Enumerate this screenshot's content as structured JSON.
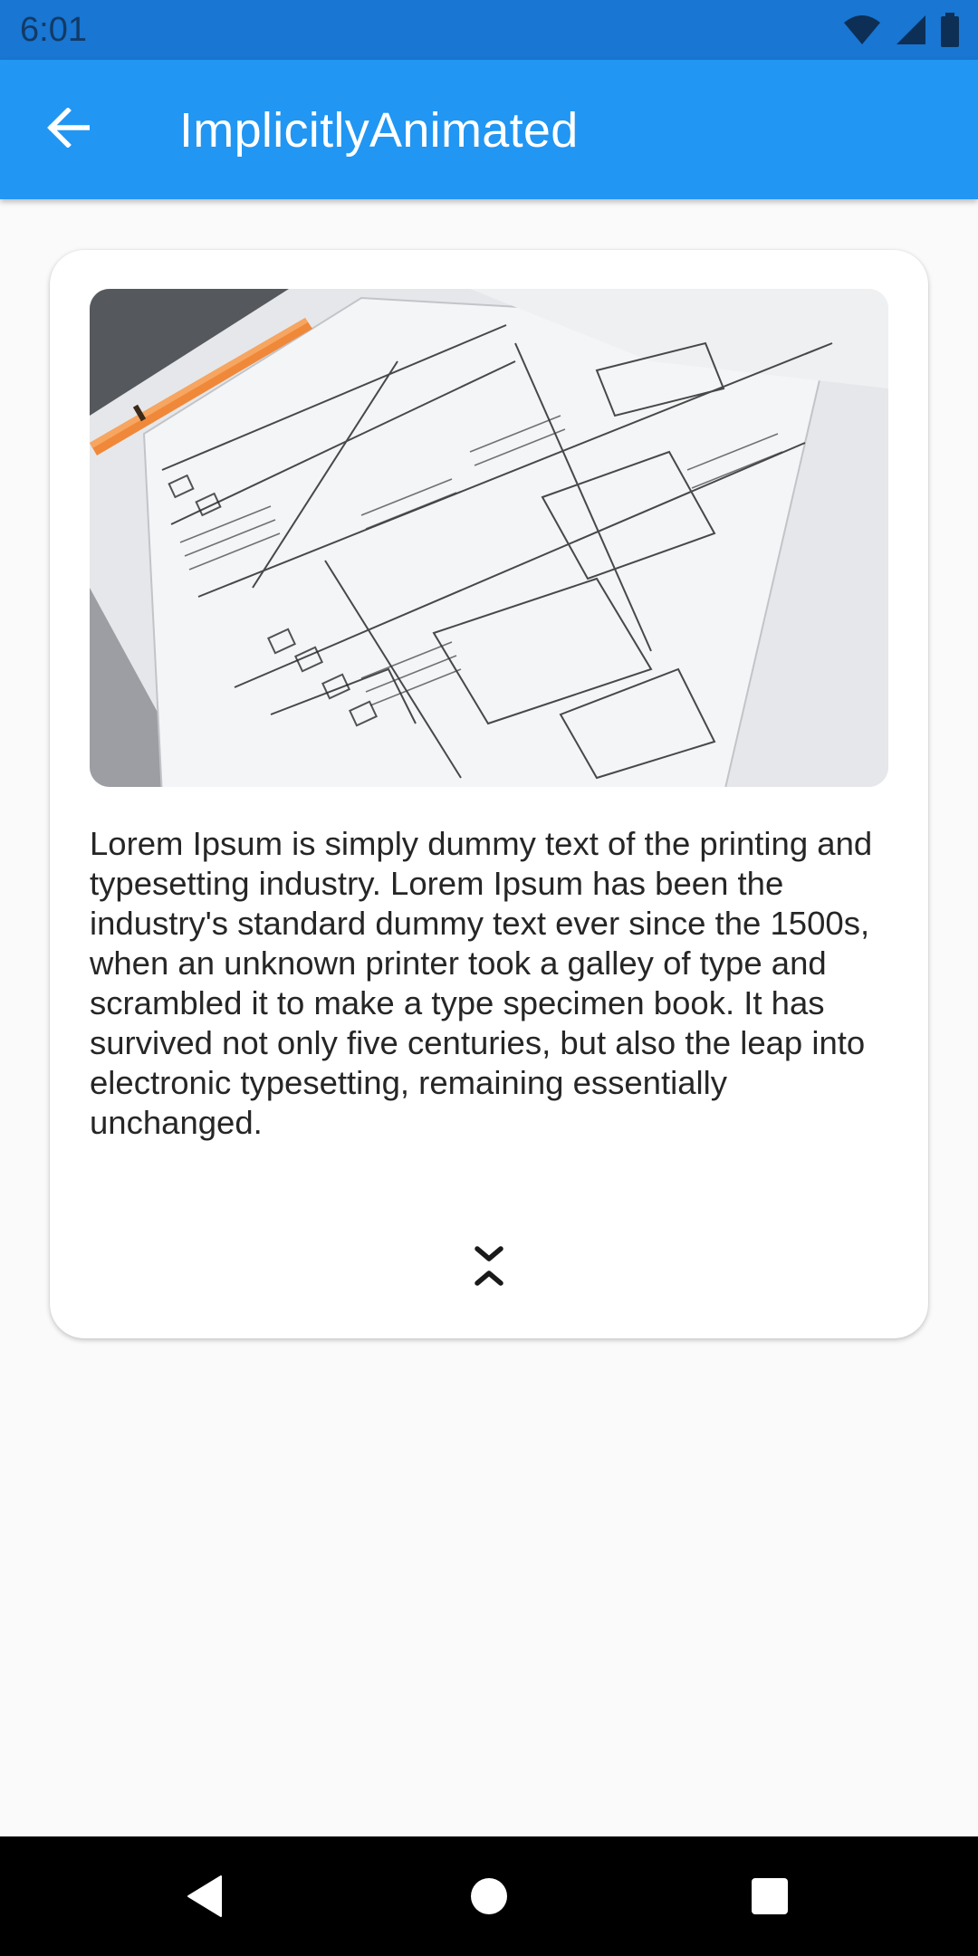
{
  "status_bar": {
    "time": "6:01",
    "icons": [
      "wifi-icon",
      "cellular-signal-icon",
      "battery-icon"
    ]
  },
  "app_bar": {
    "title": "ImplicitlyAnimated",
    "back_icon": "arrow-back-icon",
    "background_color": "#2196f3"
  },
  "card": {
    "image": "sketch-wireframe-photo",
    "body_text": "Lorem Ipsum is simply dummy text of the printing and typesetting industry. Lorem Ipsum has been the industry's standard dummy text ever since the 1500s, when an unknown printer took a galley of type and scrambled it to make a type specimen book. It has survived not only five centuries, but also the leap into electronic typesetting, remaining essentially unchanged.",
    "toggle_icon": "collapse-icon"
  },
  "nav_bar": {
    "buttons": [
      "back-triangle-icon",
      "home-circle-icon",
      "recents-square-icon"
    ]
  },
  "colors": {
    "status_bar": "#1976d2",
    "background": "#fafafa",
    "text": "#262626"
  }
}
